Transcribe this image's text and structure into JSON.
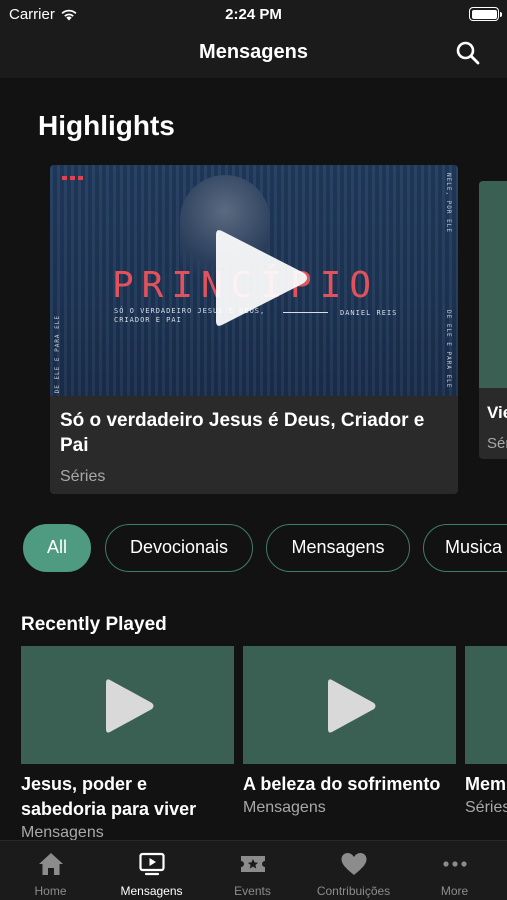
{
  "status_bar": {
    "carrier": "Carrier",
    "time": "2:24 PM"
  },
  "nav": {
    "title": "Mensagens"
  },
  "highlights": {
    "heading": "Highlights",
    "cards": [
      {
        "title": "Só o verdadeiro Jesus é Deus, Criador e Pai",
        "subtitle": "Séries",
        "thumb": {
          "word": "PRINCÍPIO",
          "sub": "SÓ O VERDADEIRO JESUS É DEUS, CRIADOR E PAI",
          "author": "DANIEL REIS",
          "side_top": "NELE, POR ELE",
          "side_bottom": "DE ELE E PARA ELE",
          "side_left": "DE ELE E PARA ELE"
        }
      },
      {
        "title": "Vie",
        "subtitle": "Séri"
      }
    ]
  },
  "filters": [
    "All",
    "Devocionais",
    "Mensagens",
    "Musica"
  ],
  "recently_played": {
    "heading": "Recently Played",
    "items": [
      {
        "title_line1": "Jesus, poder e",
        "title_line2": "sabedoria para viver",
        "subtitle": "Mensagens"
      },
      {
        "title_line1": "A beleza do sofrimento",
        "title_line2": "",
        "subtitle": "Mensagens"
      },
      {
        "title_line1": "Mem",
        "title_line2": "",
        "subtitle": "Séries"
      }
    ]
  },
  "tabs": [
    {
      "label": "Home",
      "icon": "home-icon"
    },
    {
      "label": "Mensagens",
      "icon": "tv-play-icon"
    },
    {
      "label": "Events",
      "icon": "ticket-star-icon"
    },
    {
      "label": "Contribuições",
      "icon": "heart-icon"
    },
    {
      "label": "More",
      "icon": "more-dots-icon"
    }
  ],
  "colors": {
    "accent": "#4e9b82",
    "thumb": "#3a5f53",
    "background": "#121212",
    "bar": "#1b1b1b"
  }
}
